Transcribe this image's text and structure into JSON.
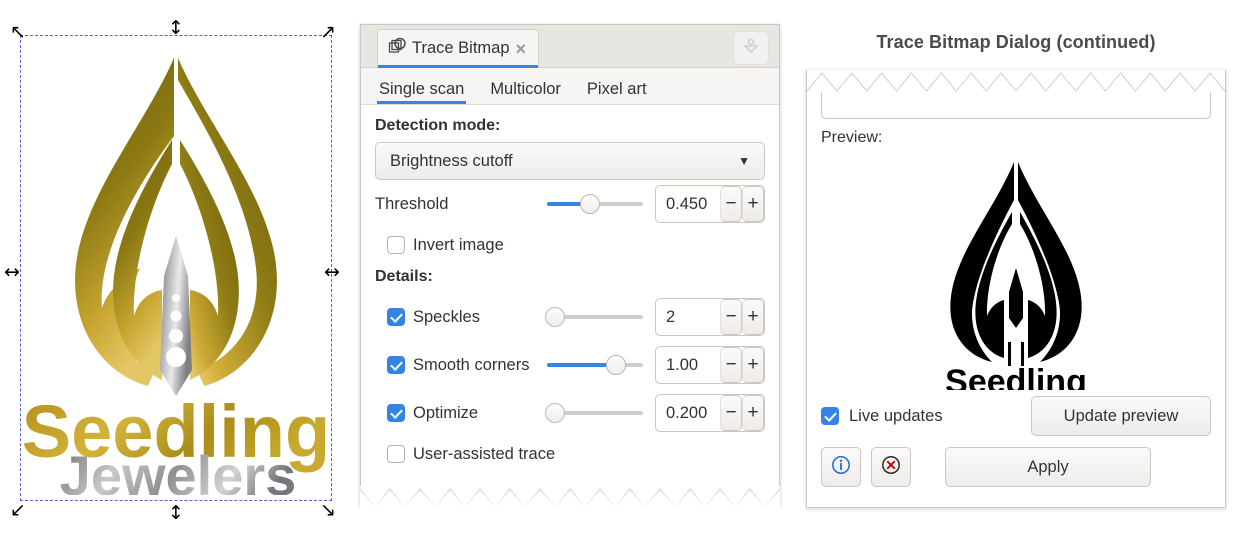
{
  "canvas": {
    "logo": {
      "brand_line1": "Seedling",
      "brand_line2": "Jewelers",
      "gold_dark": "#6f6210",
      "gold_light": "#d7b43a",
      "silver_dark": "#6e7073",
      "silver_light": "#e2e3e4",
      "selection_color": "#5b5bd6"
    },
    "handles": {
      "north": "↕",
      "south": "↕",
      "west": "↔",
      "east": "↔",
      "northwest": "↖",
      "northeast": "↗",
      "southwest": "↙",
      "southeast": "↘"
    }
  },
  "dialog": {
    "tab_title": "Trace Bitmap",
    "tab_close": "×",
    "tab_icon": "trace-bitmap-icon",
    "dock_icon": "dock-down-icon",
    "subtabs": [
      {
        "label": "Single scan",
        "active": true
      },
      {
        "label": "Multicolor",
        "active": false
      },
      {
        "label": "Pixel art",
        "active": false
      }
    ],
    "detection_mode_label": "Detection mode:",
    "detection_mode_value": "Brightness cutoff",
    "detection_mode_arrow": "▼",
    "threshold": {
      "label": "Threshold",
      "value": "0.450",
      "slider_percent": 45,
      "minus": "−",
      "plus": "+"
    },
    "invert_image": {
      "label": "Invert image",
      "checked": false
    },
    "details_label": "Details:",
    "details": [
      {
        "label": "Speckles",
        "checked": true,
        "value": "2",
        "slider_percent": 8,
        "fill_percent": 0,
        "minus": "−",
        "plus": "+"
      },
      {
        "label": "Smooth corners",
        "checked": true,
        "value": "1.00",
        "slider_percent": 72,
        "fill_percent": 72,
        "minus": "−",
        "plus": "+"
      },
      {
        "label": "Optimize",
        "checked": true,
        "value": "0.200",
        "slider_percent": 8,
        "fill_percent": 0,
        "minus": "−",
        "plus": "+"
      }
    ],
    "user_assisted_trace": {
      "label": "User-assisted trace",
      "checked": false
    },
    "accent_color": "#3584e4"
  },
  "right_panel": {
    "caption": "Trace Bitmap Dialog (continued)",
    "preview_label": "Preview:",
    "preview_alt": "traced-black-seedling-jewelers-logo",
    "preview_text_line1": "Seedling",
    "live_updates": {
      "label": "Live updates",
      "checked": true
    },
    "update_preview_label": "Update preview",
    "apply_label": "Apply",
    "info_icon": "info-icon",
    "close_icon": "close-circle-icon",
    "info_color": "#1a6fd4",
    "close_color": "#cc0000"
  }
}
